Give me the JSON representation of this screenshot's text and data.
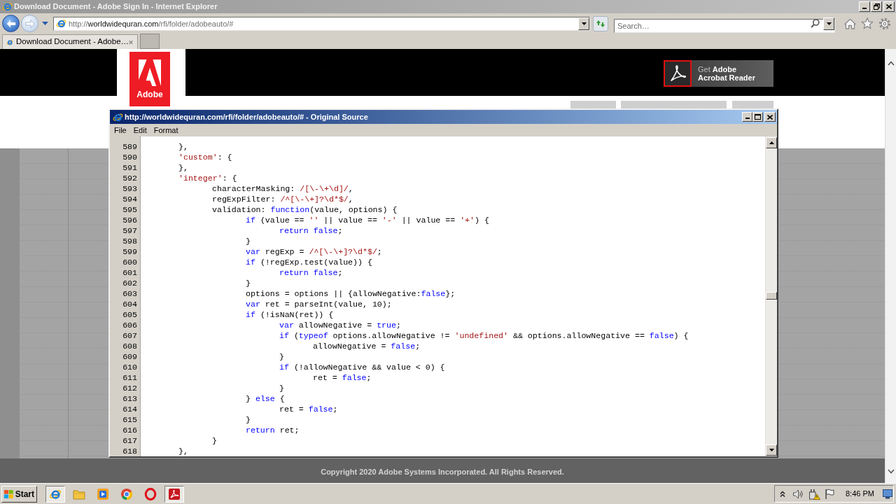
{
  "browser": {
    "title": "Download Document - Adobe Sign In - Internet Explorer",
    "address": [
      {
        "kind": "scheme",
        "text": "http://"
      },
      {
        "kind": "host",
        "text": "worldwidequran.com"
      },
      {
        "kind": "path",
        "text": "/rfi/folder/adobeauto/#"
      }
    ],
    "search": {
      "placeholder": "Search…"
    },
    "tabs": [
      {
        "label": "Download Document - Adobe…",
        "selected": true
      }
    ]
  },
  "page": {
    "logo": {
      "text": "Adobe"
    },
    "reader_button": {
      "lines": [
        "Get **Adobe**",
        "Acrobat Reader"
      ]
    },
    "footer": {
      "copyright": "Copyright 2020 Adobe Systems Incorporated. All Rights Reserved."
    }
  },
  "source_window": {
    "title": "http://worldwidequran.com/rfi/folder/adobeauto/# - Original Source",
    "menu": [
      "File",
      "Edit",
      "Format"
    ],
    "lines": [
      {
        "number": "589",
        "tokens": [
          {
            "kind": "plain",
            "text": "\t},"
          }
        ]
      },
      {
        "number": "590",
        "tokens": [
          {
            "kind": "string",
            "text": "\t'custom'"
          },
          {
            "kind": "plain",
            "text": ": {"
          }
        ]
      },
      {
        "number": "591",
        "tokens": [
          {
            "kind": "plain",
            "text": "\t},"
          }
        ]
      },
      {
        "number": "592",
        "tokens": [
          {
            "kind": "string",
            "text": "\t'integer'"
          },
          {
            "kind": "plain",
            "text": ": {"
          }
        ]
      },
      {
        "number": "593",
        "tokens": [
          {
            "kind": "plain",
            "text": "\t\tcharacterMasking: "
          },
          {
            "kind": "string",
            "text": "/[\\-\\+\\d]/"
          },
          {
            "kind": "plain",
            "text": ","
          }
        ]
      },
      {
        "number": "594",
        "tokens": [
          {
            "kind": "plain",
            "text": "\t\tregExpFilter: "
          },
          {
            "kind": "string",
            "text": "/^[\\-\\+]?\\d*$/"
          },
          {
            "kind": "plain",
            "text": ","
          }
        ]
      },
      {
        "number": "595",
        "tokens": [
          {
            "kind": "plain",
            "text": "\t\tvalidation: "
          },
          {
            "kind": "keyword",
            "text": "function"
          },
          {
            "kind": "plain",
            "text": "(value, options) {"
          }
        ]
      },
      {
        "number": "596",
        "tokens": [
          {
            "kind": "keyword",
            "text": "\t\t\tif"
          },
          {
            "kind": "plain",
            "text": " (value == "
          },
          {
            "kind": "string",
            "text": "''"
          },
          {
            "kind": "plain",
            "text": " || value == "
          },
          {
            "kind": "string",
            "text": "'-'"
          },
          {
            "kind": "plain",
            "text": " || value == "
          },
          {
            "kind": "string",
            "text": "'+'"
          },
          {
            "kind": "plain",
            "text": ") {"
          }
        ]
      },
      {
        "number": "597",
        "tokens": [
          {
            "kind": "keyword",
            "text": "\t\t\t\treturn false"
          },
          {
            "kind": "plain",
            "text": ";"
          }
        ]
      },
      {
        "number": "598",
        "tokens": [
          {
            "kind": "plain",
            "text": "\t\t\t}"
          }
        ]
      },
      {
        "number": "599",
        "tokens": [
          {
            "kind": "keyword",
            "text": "\t\t\tvar"
          },
          {
            "kind": "plain",
            "text": " regExp = "
          },
          {
            "kind": "string",
            "text": "/^[\\-\\+]?\\d*$/"
          },
          {
            "kind": "plain",
            "text": ";"
          }
        ]
      },
      {
        "number": "600",
        "tokens": [
          {
            "kind": "keyword",
            "text": "\t\t\tif"
          },
          {
            "kind": "plain",
            "text": " (!regExp.test(value)) {"
          }
        ]
      },
      {
        "number": "601",
        "tokens": [
          {
            "kind": "keyword",
            "text": "\t\t\t\treturn false"
          },
          {
            "kind": "plain",
            "text": ";"
          }
        ]
      },
      {
        "number": "602",
        "tokens": [
          {
            "kind": "plain",
            "text": "\t\t\t}"
          }
        ]
      },
      {
        "number": "603",
        "tokens": [
          {
            "kind": "plain",
            "text": "\t\t\toptions = options || {allowNegative:"
          },
          {
            "kind": "keyword",
            "text": "false"
          },
          {
            "kind": "plain",
            "text": "};"
          }
        ]
      },
      {
        "number": "604",
        "tokens": [
          {
            "kind": "keyword",
            "text": "\t\t\tvar"
          },
          {
            "kind": "plain",
            "text": " ret = parseInt(value, 10);"
          }
        ]
      },
      {
        "number": "605",
        "tokens": [
          {
            "kind": "keyword",
            "text": "\t\t\tif"
          },
          {
            "kind": "plain",
            "text": " (!isNaN(ret)) {"
          }
        ]
      },
      {
        "number": "606",
        "tokens": [
          {
            "kind": "keyword",
            "text": "\t\t\t\tvar"
          },
          {
            "kind": "plain",
            "text": " allowNegative = "
          },
          {
            "kind": "keyword",
            "text": "true"
          },
          {
            "kind": "plain",
            "text": ";"
          }
        ]
      },
      {
        "number": "607",
        "tokens": [
          {
            "kind": "keyword",
            "text": "\t\t\t\tif"
          },
          {
            "kind": "plain",
            "text": " ("
          },
          {
            "kind": "keyword",
            "text": "typeof"
          },
          {
            "kind": "plain",
            "text": " options.allowNegative != "
          },
          {
            "kind": "string",
            "text": "'undefined'"
          },
          {
            "kind": "plain",
            "text": " && options.allowNegative == "
          },
          {
            "kind": "keyword",
            "text": "false"
          },
          {
            "kind": "plain",
            "text": ") {"
          }
        ]
      },
      {
        "number": "608",
        "tokens": [
          {
            "kind": "plain",
            "text": "\t\t\t\t\tallowNegative = "
          },
          {
            "kind": "keyword",
            "text": "false"
          },
          {
            "kind": "plain",
            "text": ";"
          }
        ]
      },
      {
        "number": "609",
        "tokens": [
          {
            "kind": "plain",
            "text": "\t\t\t\t}"
          }
        ]
      },
      {
        "number": "610",
        "tokens": [
          {
            "kind": "keyword",
            "text": "\t\t\t\tif"
          },
          {
            "kind": "plain",
            "text": " (!allowNegative && value < 0) {"
          }
        ]
      },
      {
        "number": "611",
        "tokens": [
          {
            "kind": "plain",
            "text": "\t\t\t\t\tret = "
          },
          {
            "kind": "keyword",
            "text": "false"
          },
          {
            "kind": "plain",
            "text": ";"
          }
        ]
      },
      {
        "number": "612",
        "tokens": [
          {
            "kind": "plain",
            "text": "\t\t\t\t}"
          }
        ]
      },
      {
        "number": "613",
        "tokens": [
          {
            "kind": "plain",
            "text": "\t\t\t} "
          },
          {
            "kind": "keyword",
            "text": "else"
          },
          {
            "kind": "plain",
            "text": " {"
          }
        ]
      },
      {
        "number": "614",
        "tokens": [
          {
            "kind": "plain",
            "text": "\t\t\t\tret = "
          },
          {
            "kind": "keyword",
            "text": "false"
          },
          {
            "kind": "plain",
            "text": ";"
          }
        ]
      },
      {
        "number": "615",
        "tokens": [
          {
            "kind": "plain",
            "text": "\t\t\t}"
          }
        ]
      },
      {
        "number": "616",
        "tokens": [
          {
            "kind": "keyword",
            "text": "\t\t\treturn"
          },
          {
            "kind": "plain",
            "text": " ret;"
          }
        ]
      },
      {
        "number": "617",
        "tokens": [
          {
            "kind": "plain",
            "text": "\t\t}"
          }
        ]
      },
      {
        "number": "618",
        "tokens": [
          {
            "kind": "plain",
            "text": "\t},"
          }
        ]
      }
    ]
  },
  "taskbar": {
    "start": "Start",
    "apps": [
      {
        "kind": "e-logo",
        "active": true
      },
      {
        "kind": "folder",
        "active": false
      },
      {
        "kind": "player",
        "active": false
      },
      {
        "kind": "circle-logo",
        "active": false
      },
      {
        "kind": "o-logo",
        "active": false
      },
      {
        "kind": "pdf",
        "active": true
      }
    ],
    "clock": "8:46 PM"
  }
}
